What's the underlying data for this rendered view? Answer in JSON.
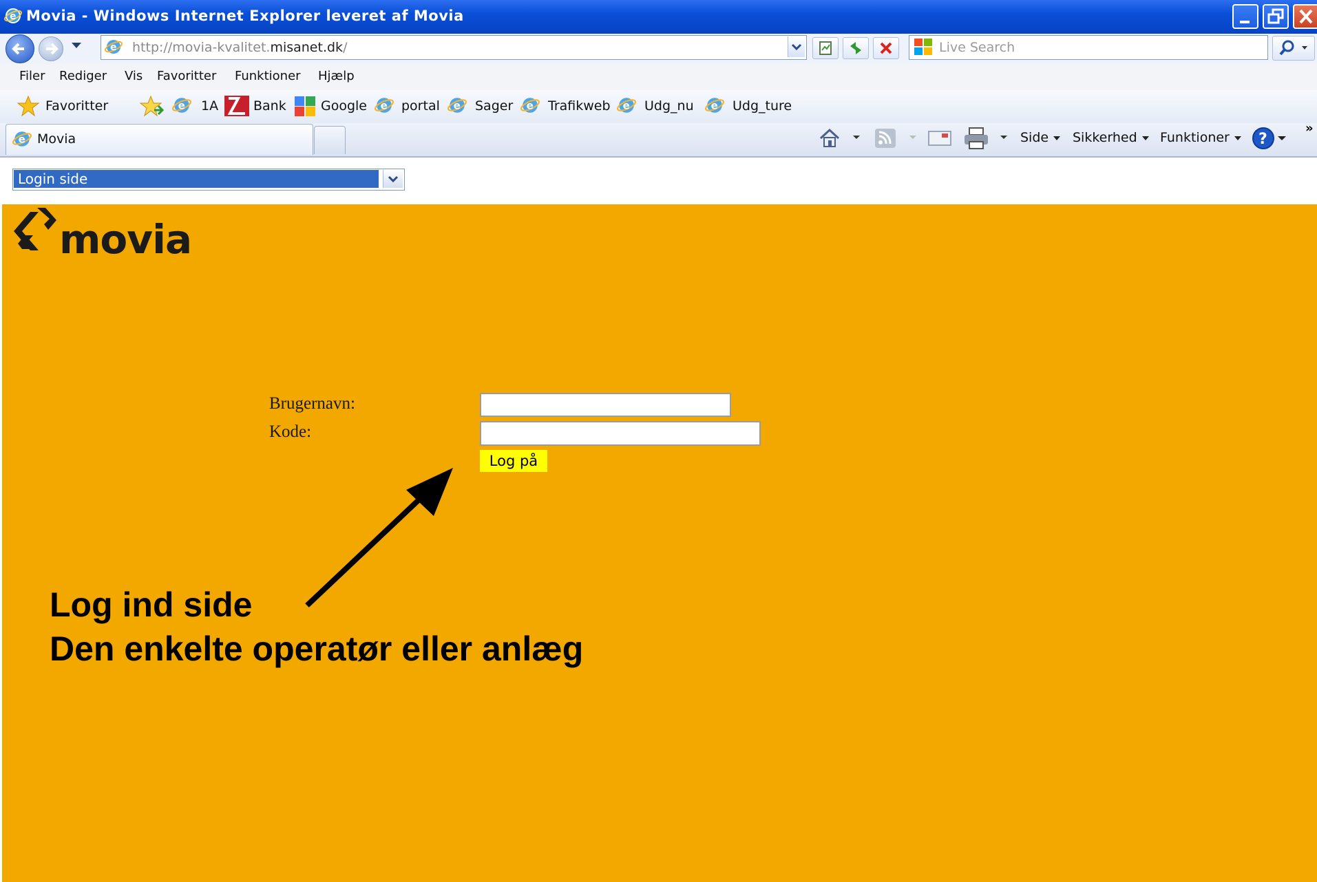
{
  "window": {
    "title": "Movia - Windows Internet Explorer leveret af Movia"
  },
  "address_bar": {
    "url_prefix": "http://movia-kvalitet.",
    "url_domain": "misanet.dk",
    "url_suffix": "/",
    "search_placeholder": "Live Search"
  },
  "menu": {
    "items": [
      "Filer",
      "Rediger",
      "Vis",
      "Favoritter",
      "Funktioner",
      "Hjælp"
    ]
  },
  "favorites_bar": {
    "favorites_label": "Favoritter",
    "links": [
      "1A",
      "Bank",
      "Google",
      "portal",
      "Sager",
      "Trafikweb",
      "Udg_nu",
      "Udg_ture"
    ]
  },
  "tabs": {
    "active_tab": "Movia"
  },
  "command_bar": {
    "side": "Side",
    "sikkerhed": "Sikkerhed",
    "funktioner": "Funktioner",
    "chevron": "»"
  },
  "page": {
    "page_select": "Login side",
    "logo_text": "movia",
    "form": {
      "username_label": "Brugernavn:",
      "password_label": "Kode:",
      "username_value": "",
      "password_value": "",
      "login_button": "Log på"
    },
    "annotation": {
      "line1": "Log ind side",
      "line2": "Den enkelte operatør eller anlæg"
    }
  },
  "colors": {
    "page_background": "#f3a800",
    "login_button": "#ffff00",
    "titlebar": "#0a4fd8",
    "select_highlight": "#316ac5"
  },
  "icons": [
    "ie-icon",
    "back-icon",
    "forward-icon",
    "refresh-icon",
    "stop-icon",
    "compatibility-icon",
    "search-icon",
    "star-icon",
    "add-favorite-icon",
    "home-icon",
    "rss-icon",
    "mail-icon",
    "print-icon",
    "help-icon"
  ]
}
